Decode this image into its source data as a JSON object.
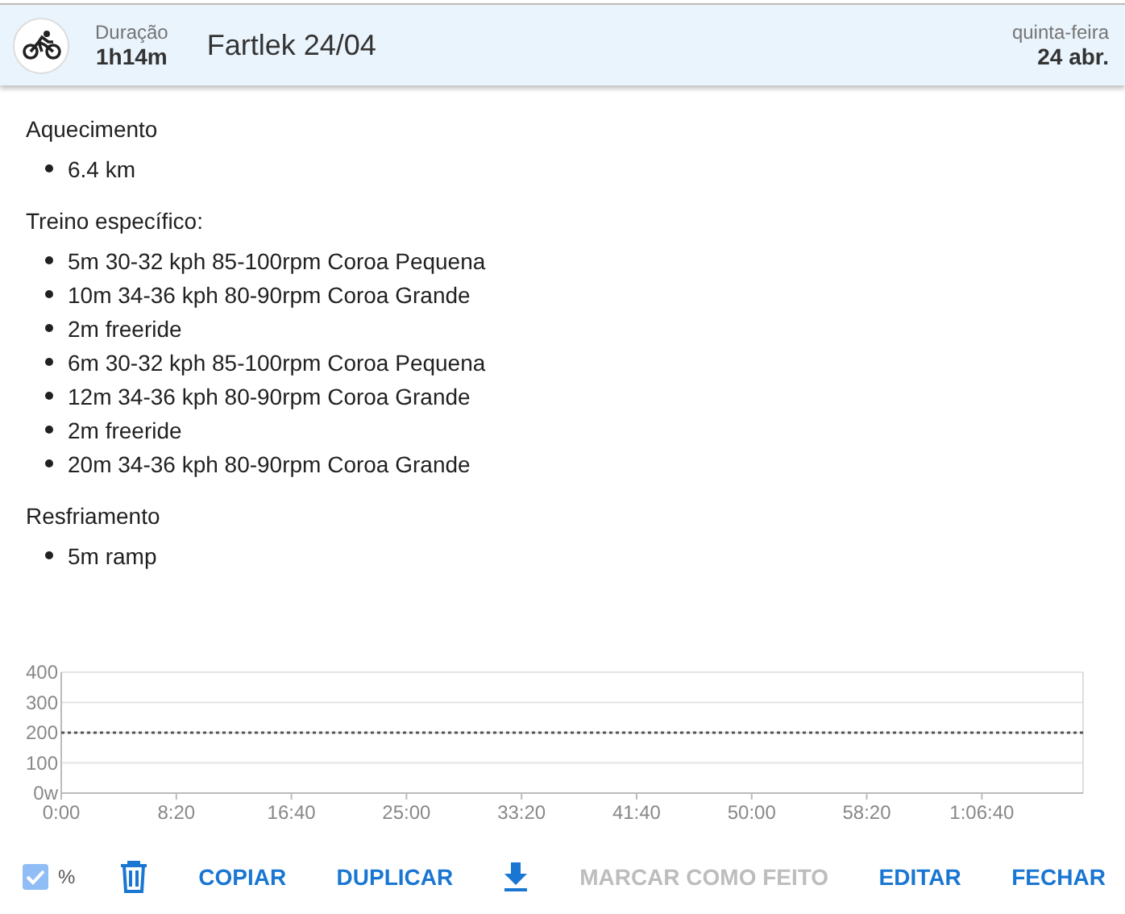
{
  "header": {
    "duration_label": "Duração",
    "duration": "1h14m",
    "title": "Fartlek 24/04",
    "weekday": "quinta-feira",
    "date": "24 abr."
  },
  "sections": [
    {
      "heading": "Aquecimento",
      "items": [
        "6.4 km"
      ]
    },
    {
      "heading": "Treino específico:",
      "items": [
        "5m 30-32 kph 85-100rpm Coroa Pequena",
        "10m 34-36 kph 80-90rpm Coroa Grande",
        "2m freeride",
        "6m 30-32 kph 85-100rpm Coroa Pequena",
        "12m 34-36 kph 80-90rpm Coroa Grande",
        "2m freeride",
        "20m 34-36 kph 80-90rpm Coroa Grande"
      ]
    },
    {
      "heading": "Resfriamento",
      "items": [
        "5m ramp"
      ]
    }
  ],
  "chart": {
    "chart_data": {
      "type": "line",
      "x": [
        0,
        4440
      ],
      "grid": true,
      "series": [
        {
          "color": "#555555",
          "line_style": "dotted",
          "values": [
            200,
            200
          ]
        }
      ],
      "xlim": [
        0,
        4440
      ],
      "ylim": [
        0,
        400
      ],
      "xticks": [
        {
          "value": 0,
          "label": "0:00"
        },
        {
          "value": 500,
          "label": "8:20"
        },
        {
          "value": 1000,
          "label": "16:40"
        },
        {
          "value": 1500,
          "label": "25:00"
        },
        {
          "value": 2000,
          "label": "33:20"
        },
        {
          "value": 2500,
          "label": "41:40"
        },
        {
          "value": 3000,
          "label": "50:00"
        },
        {
          "value": 3500,
          "label": "58:20"
        },
        {
          "value": 4000,
          "label": "1:06:40"
        }
      ],
      "yticks": [
        {
          "value": 0,
          "label": "0w"
        },
        100,
        200,
        300,
        400
      ]
    }
  },
  "actions": [
    {
      "kind": "checkbox",
      "label": "%",
      "checked": true
    },
    {
      "kind": "trash"
    },
    {
      "kind": "text",
      "label": "COPIAR",
      "disabled": false
    },
    {
      "kind": "text",
      "label": "DUPLICAR",
      "disabled": false
    },
    {
      "kind": "download"
    },
    {
      "kind": "text",
      "label": "MARCAR COMO FEITO",
      "disabled": true
    },
    {
      "kind": "text",
      "label": "EDITAR",
      "disabled": false
    },
    {
      "kind": "text",
      "label": "FECHAR",
      "disabled": false
    }
  ]
}
